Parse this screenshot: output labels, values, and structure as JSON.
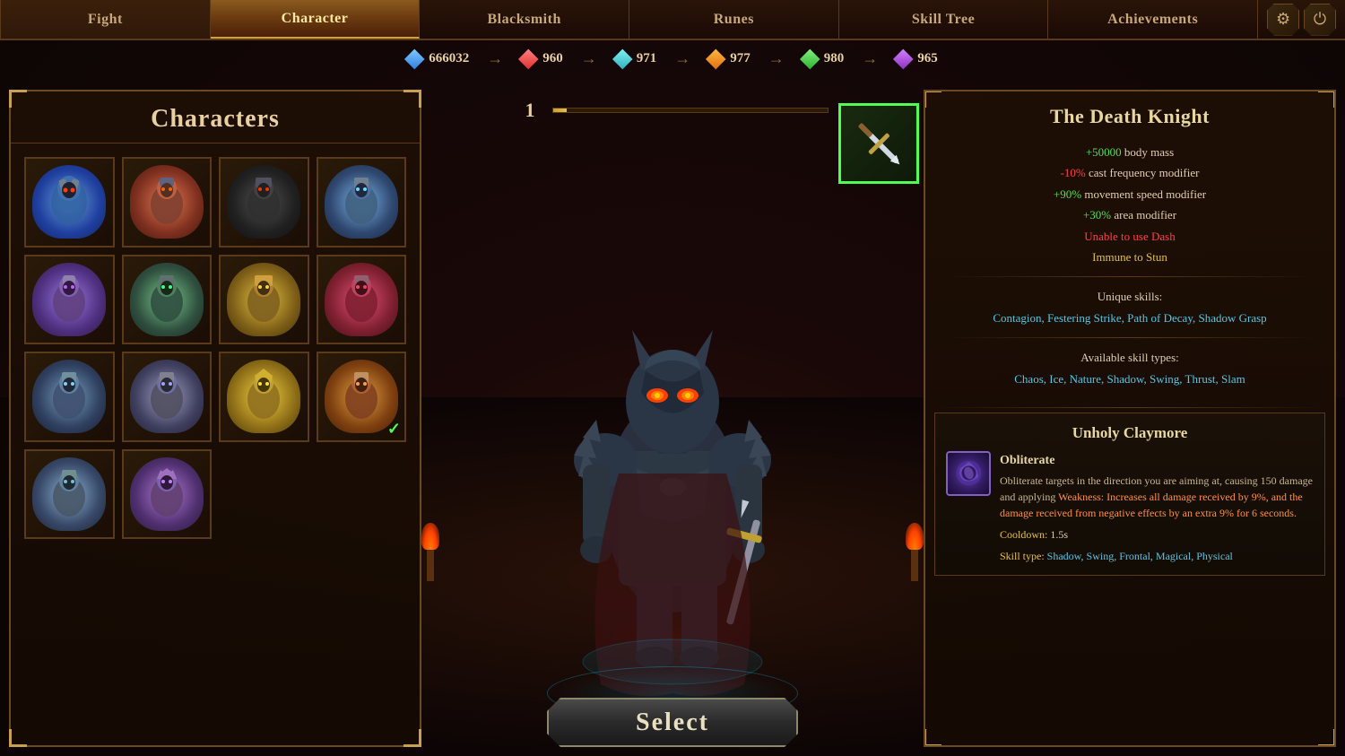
{
  "nav": {
    "tabs": [
      {
        "id": "fight",
        "label": "Fight",
        "active": false
      },
      {
        "id": "character",
        "label": "Character",
        "active": true
      },
      {
        "id": "blacksmith",
        "label": "Blacksmith",
        "active": false
      },
      {
        "id": "runes",
        "label": "Runes",
        "active": false
      },
      {
        "id": "skill_tree",
        "label": "Skill Tree",
        "active": false
      },
      {
        "id": "achievements",
        "label": "Achievements",
        "active": false
      }
    ]
  },
  "currency": [
    {
      "id": "gems",
      "value": "666032",
      "color": "blue"
    },
    {
      "id": "red_gems",
      "value": "960",
      "color": "red"
    },
    {
      "id": "cyan_gems",
      "value": "971",
      "color": "cyan"
    },
    {
      "id": "orange_gems",
      "value": "977",
      "color": "orange"
    },
    {
      "id": "green_gems",
      "value": "980",
      "color": "green"
    },
    {
      "id": "purple_gems",
      "value": "965",
      "color": "purple"
    }
  ],
  "characters_panel": {
    "title": "Characters",
    "grid_count": 14
  },
  "level": {
    "number": "1",
    "fill_pct": 5
  },
  "select_button": "Select",
  "weapon_slot": {
    "border_color": "#50ff50"
  },
  "character_info": {
    "name": "The Death Knight",
    "stats": [
      {
        "text": "+50000 body mass",
        "color": "green"
      },
      {
        "text": "-10% cast frequency modifier",
        "color": "red"
      },
      {
        "text": "+90% movement speed modifier",
        "color": "green"
      },
      {
        "text": "+30% area modifier",
        "color": "green"
      },
      {
        "text": "Unable to use Dash",
        "color": "red"
      },
      {
        "text": "Immune to Stun",
        "color": "yellow"
      }
    ],
    "unique_skills_label": "Unique skills:",
    "unique_skills": "Contagion, Festering Strike, Path of Decay, Shadow Grasp",
    "skill_types_label": "Available skill types:",
    "skill_types": "Chaos, Ice, Nature, Shadow, Swing, Thrust, Slam"
  },
  "weapon": {
    "name": "Unholy Claymore",
    "ability_name": "Obliterate",
    "ability_desc": "Obliterate targets in the direction you are aiming at, causing 150 damage and applying ",
    "weakness_word": "Weakness",
    "weakness_desc": ": Increases all damage received by 9%, and the damage received from negative effects by an extra 9% for 6 seconds.",
    "weakness_label": "Weakness",
    "cooldown_label": "Cooldown:",
    "cooldown_value": "1.5s",
    "skill_type_label": "Skill type:",
    "skill_types": "Shadow, Swing, Frontal, Magical, Physical"
  }
}
